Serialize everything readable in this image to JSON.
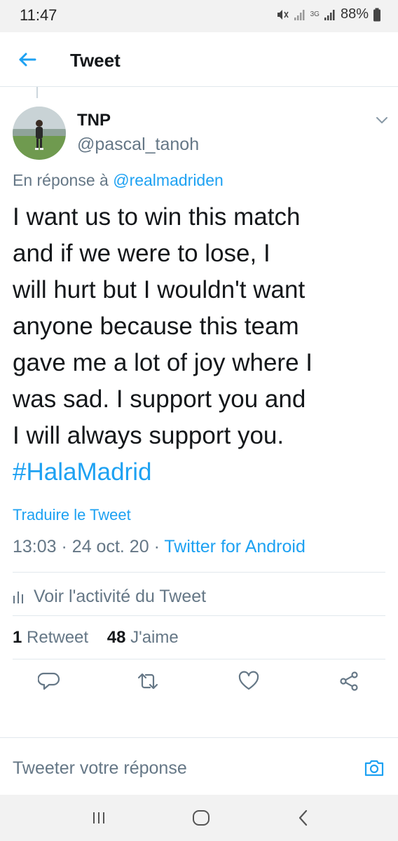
{
  "status_bar": {
    "time": "11:47",
    "network": "3G",
    "battery": "88%"
  },
  "header": {
    "title": "Tweet",
    "back_icon": "arrow-left-icon"
  },
  "tweet": {
    "author_name": "TNP",
    "author_handle": "@pascal_tanoh",
    "reply_prefix": "En réponse à",
    "reply_mention": "@realmadriden",
    "text_lines": [
      "I want us to win this match",
      "and if we were to lose, I",
      "will hurt but I wouldn't want",
      "anyone because this team",
      "gave me a lot of joy where I",
      "was sad.  I support you and",
      "I will always support you."
    ],
    "hashtag": "#HalaMadrid",
    "translate_label": "Traduire le Tweet",
    "time": "13:03",
    "date": "24 oct. 20",
    "source": "Twitter for Android",
    "activity_label": "Voir l'activité du Tweet",
    "retweet_count": "1",
    "retweet_label": "Retweet",
    "like_count": "48",
    "like_label": "J'aime"
  },
  "actions": [
    "reply-icon",
    "retweet-icon",
    "like-icon",
    "share-icon"
  ],
  "reply_box": {
    "placeholder": "Tweeter votre réponse",
    "camera_icon": "camera-icon"
  },
  "colors": {
    "accent": "#1da1f2",
    "secondary_text": "#657786",
    "divider": "#e1e8ed"
  }
}
